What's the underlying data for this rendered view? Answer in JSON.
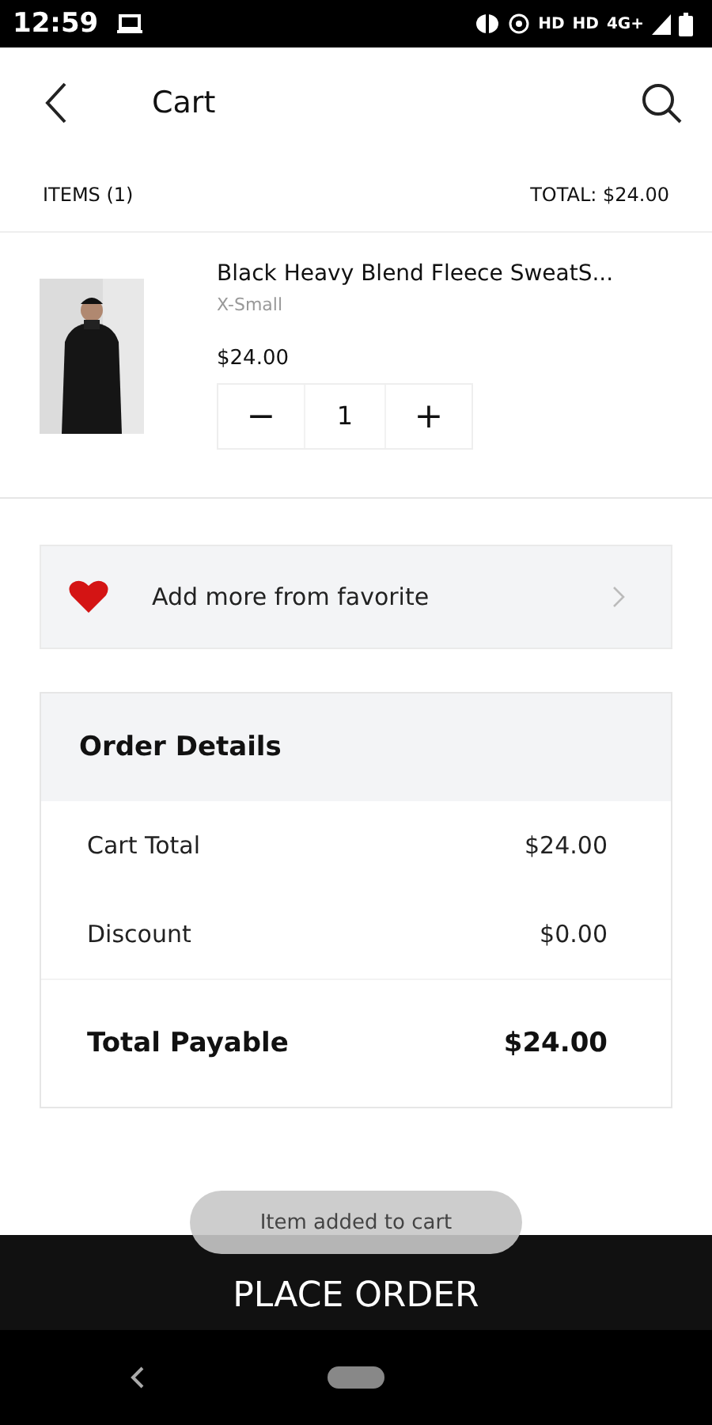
{
  "status_bar": {
    "time": "12:59",
    "indicators": [
      "HD",
      "HD",
      "4G+"
    ]
  },
  "header": {
    "title": "Cart"
  },
  "summary": {
    "items": "ITEMS (1)",
    "total": "TOTAL: $24.00"
  },
  "cart_items": [
    {
      "name": "Black Heavy Blend Fleece SweatS...",
      "size": "X-Small",
      "price": "$24.00",
      "quantity": "1",
      "decrement": "−",
      "increment": "+"
    }
  ],
  "favorites": {
    "label": "Add more from favorite"
  },
  "order_details": {
    "title": "Order Details",
    "rows": [
      {
        "label": "Cart Total",
        "value": "$24.00",
        "kind": "line"
      },
      {
        "label": "Discount",
        "value": "$0.00",
        "kind": "line"
      },
      {
        "label": "Total Payable",
        "value": "$24.00",
        "kind": "total"
      }
    ]
  },
  "toast": "Item added to cart",
  "place_order": "PLACE ORDER"
}
